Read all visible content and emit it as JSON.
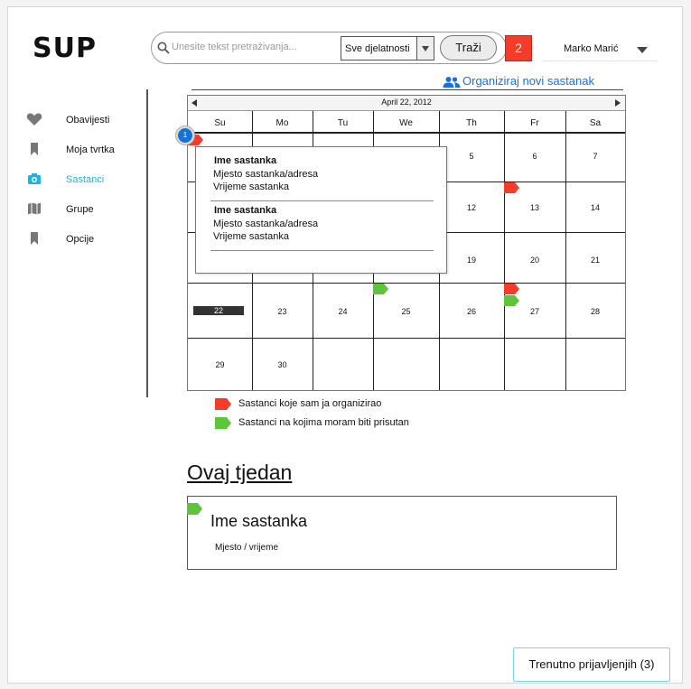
{
  "app": {
    "logo": "SUP"
  },
  "search": {
    "placeholder": "Unesite tekst pretraživanja...",
    "category": "Sve djelatnosti",
    "button": "Traži"
  },
  "notifications": {
    "count": "2"
  },
  "user": {
    "name": "Marko Marić"
  },
  "sidebar": {
    "items": [
      {
        "label": "Obavijesti",
        "icon": "heart-icon",
        "active": false
      },
      {
        "label": "Moja tvrtka",
        "icon": "bookmark-icon",
        "active": false
      },
      {
        "label": "Sastanci",
        "icon": "camera-icon",
        "active": true
      },
      {
        "label": "Grupe",
        "icon": "map-icon",
        "active": false
      },
      {
        "label": "Opcije",
        "icon": "bookmark-icon",
        "active": false
      }
    ]
  },
  "new_meeting": {
    "label": "Organiziraj novi sastanak",
    "icon": "people-icon"
  },
  "calendar": {
    "title": "April 22, 2012",
    "weekdays": [
      "Su",
      "Mo",
      "Tu",
      "We",
      "Th",
      "Fr",
      "Sa"
    ],
    "weeks": [
      [
        "",
        "",
        "",
        "",
        "5",
        "6",
        "7"
      ],
      [
        "",
        "",
        "",
        "",
        "12",
        "13",
        "14"
      ],
      [
        "",
        "",
        "",
        "",
        "19",
        "20",
        "21"
      ],
      [
        "22",
        "23",
        "24",
        "25",
        "26",
        "27",
        "28"
      ],
      [
        "29",
        "30",
        "",
        "",
        "",
        "",
        ""
      ]
    ],
    "today": "22",
    "event_badge": "1",
    "popup": [
      {
        "title": "Ime sastanka",
        "place": "Mjesto sastanka/adresa",
        "time": "Vrijeme sastanka"
      },
      {
        "title": "Ime sastanka",
        "place": "Mjesto sastanka/adresa",
        "time": "Vrijeme sastanka"
      }
    ]
  },
  "legend": {
    "organized": {
      "label": "Sastanci koje sam ja organizirao",
      "color": "#f53b2a"
    },
    "attending": {
      "label": "Sastanci na kojima moram biti prisutan",
      "color": "#5ec43a"
    }
  },
  "this_week": {
    "title": "Ovaj tjedan",
    "meeting": {
      "title": "Ime sastanka",
      "subtitle": "Mjesto / vrijeme"
    }
  },
  "online_users": {
    "label": "Trenutno prijavljenjih (3)"
  }
}
